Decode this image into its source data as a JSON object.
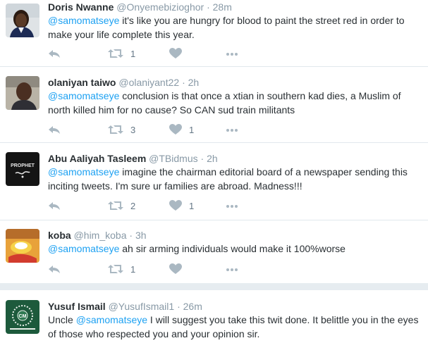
{
  "tweets": [
    {
      "name": "Doris Nwanne",
      "handle": "@Onyemebizioghor",
      "dot": "·",
      "time": "28m",
      "mention": "@samomatseye",
      "text": " it's like you are hungry for blood to paint the street red in order to make your life complete this year.",
      "retweets": "1",
      "likes": ""
    },
    {
      "name": "olaniyan taiwo",
      "handle": "@olaniyant22",
      "dot": "·",
      "time": "2h",
      "mention": "@samomatseye",
      "text": " conclusion is that once a xtian in southern kad dies, a Muslim of north killed him for no cause? So CAN sud train militants",
      "retweets": "3",
      "likes": "1"
    },
    {
      "name": "Abu Aaliyah Tasleem",
      "handle": "@TBidmus",
      "dot": "·",
      "time": "2h",
      "mention": "@samomatseye",
      "text": " imagine the chairman editorial board of a newspaper sending this inciting tweets. I'm sure ur families are abroad. Madness!!!",
      "retweets": "2",
      "likes": "1"
    },
    {
      "name": "koba",
      "handle": "@him_koba",
      "dot": "·",
      "time": "3h",
      "mention": "@samomatseye",
      "text": " ah sir arming individuals would make it 100%worse",
      "retweets": "1",
      "likes": ""
    },
    {
      "name": "Yusuf Ismail",
      "handle": "@YusufIsmail1",
      "dot": "·",
      "time": "26m",
      "prefix": "Uncle ",
      "mention": "@samomatseye",
      "text": " I will suggest you take this twit done. It belittle you in the eyes of those who respected you and your opinion sir."
    }
  ],
  "avatar_3_logo_text": "PROPHET",
  "avatar_5_logo_text": "CM",
  "icons": [
    "reply-icon",
    "retweet-icon",
    "like-icon",
    "more-icon"
  ],
  "colors": {
    "link": "#1da1f2",
    "muted": "#8899a6",
    "icon": "#aab8c2",
    "separator": "#e6ecf0"
  }
}
